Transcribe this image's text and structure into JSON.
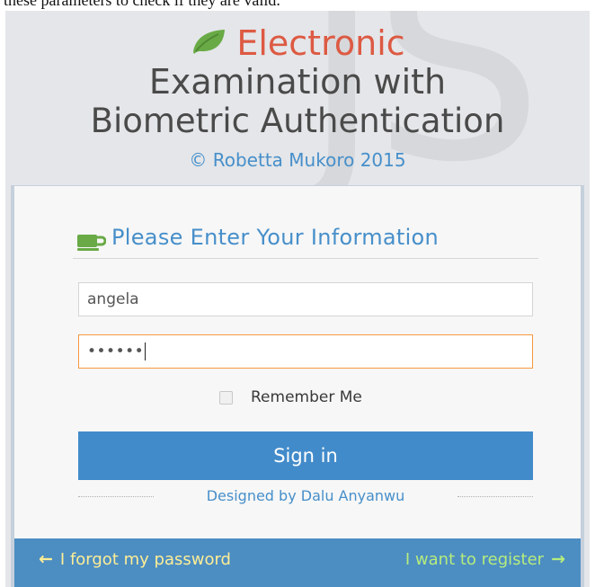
{
  "document": {
    "cropped_line": "these parameters to check if they are valid."
  },
  "brand": {
    "line1": "Electronic",
    "line2": "Examination with",
    "line3": "Biometric Authentication",
    "copyright": "© Robetta Mukoro 2015",
    "accent_color": "#dd5a43",
    "leaf_color": "#69aa46"
  },
  "login": {
    "header": "Please Enter Your Information",
    "username_value": "angela",
    "password_mask": "••••••",
    "remember_label": "Remember Me",
    "remember_checked": false,
    "signin_label": "Sign in",
    "designed_by": "Designed by Dalu Anyanwu",
    "button_color": "#428bca"
  },
  "footer": {
    "forgot_label": "I forgot my password",
    "register_label": "I want to register",
    "forgot_arrow": "←",
    "register_arrow": "→",
    "background": "#4c8dc2"
  }
}
